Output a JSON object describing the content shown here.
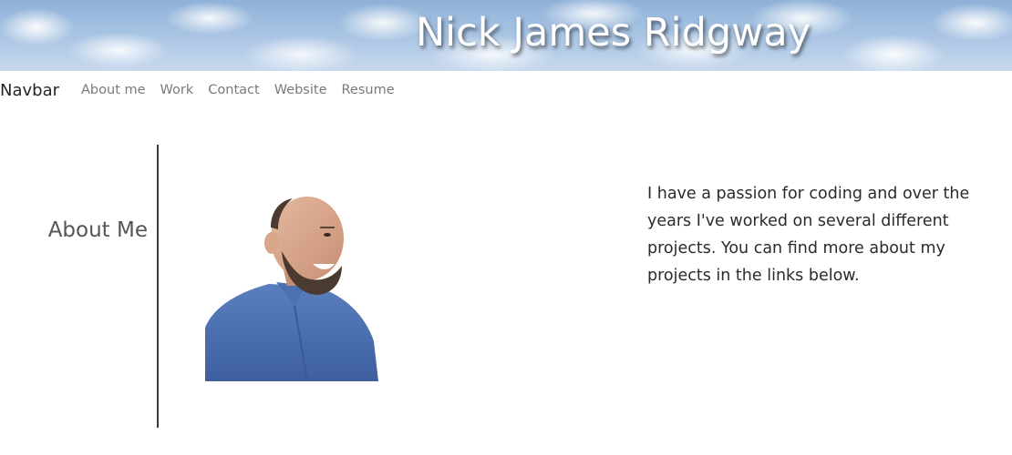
{
  "header": {
    "title": "Nick James Ridgway"
  },
  "navbar": {
    "brand": "Navbar",
    "links": [
      "About me",
      "Work",
      "Contact",
      "Website",
      "Resume"
    ]
  },
  "about": {
    "heading": "About Me",
    "bio": "I have a passion for coding and over the years I've worked on several different projects. You can find more about my projects in the links below."
  },
  "colors": {
    "banner_sky": "#a9c4e3",
    "shirt": "#4a6fb0",
    "nav_link": "#7a7a7a"
  },
  "icons": {
    "portrait": "person-photo"
  }
}
